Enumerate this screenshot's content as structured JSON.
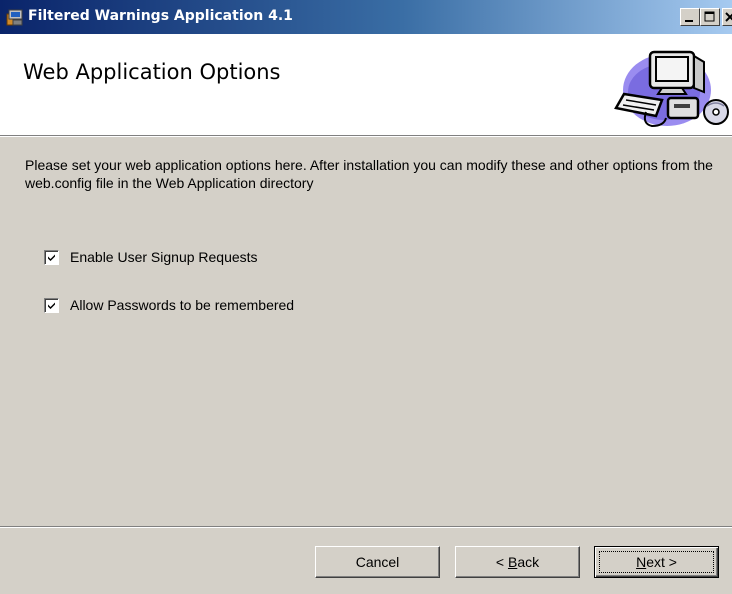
{
  "window": {
    "title": "Filtered Warnings Application 4.1"
  },
  "header": {
    "title": "Web Application Options"
  },
  "main": {
    "description": "Please set your web application options here. After installation you can modify these and other options from the web.config file in the Web Application directory",
    "options": [
      {
        "label": "Enable User Signup Requests",
        "checked": true
      },
      {
        "label": "Allow Passwords to be remembered",
        "checked": true
      }
    ]
  },
  "footer": {
    "cancel_label": "Cancel",
    "back_prefix": "< ",
    "back_accel": "B",
    "back_rest": "ack",
    "next_accel": "N",
    "next_rest": "ext >"
  },
  "icons": {
    "app": "installer-icon",
    "header": "computer-icon",
    "minimize": "minimize-icon",
    "maximize": "maximize-icon",
    "close": "close-icon",
    "check": "checkmark-icon"
  },
  "colors": {
    "titlebar_start": "#0a246a",
    "titlebar_end": "#a6caf0",
    "face": "#d4d0c8"
  }
}
